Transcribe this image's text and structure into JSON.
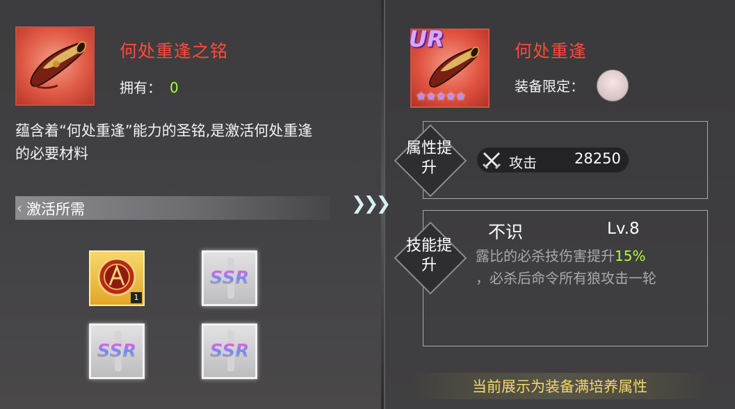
{
  "left": {
    "item_name": "何处重逢之铭",
    "owned_label": "拥有：",
    "owned_value": "0",
    "description": "蕴含着“何处重逢”能力的圣铭,是激活何处重逢的必要材料",
    "section_title": "激活所需",
    "materials": [
      {
        "type": "gold-emblem",
        "count": "1"
      },
      {
        "type": "ssr",
        "label": "SSR"
      },
      {
        "type": "ssr",
        "label": "SSR"
      },
      {
        "type": "ssr",
        "label": "SSR"
      }
    ]
  },
  "right": {
    "rarity_badge": "UR",
    "stars": "★★★★★",
    "equip_name": "何处重逢",
    "limit_label": "装备限定：",
    "attr_title": "属性提升",
    "attr_name": "攻击",
    "attr_value": "28250",
    "skill_title": "技能提升",
    "skill_name": "不识",
    "skill_level": "Lv.8",
    "skill_desc_part1": "露比的必杀技伤害提升",
    "skill_desc_highlight": "15%",
    "skill_desc_part2": "，必杀后命令所有狼攻击一轮",
    "footer_note": "当前展示为装备满培养属性"
  },
  "colors": {
    "title_red": "#ff4a3b",
    "owned_green": "#a6ff3a",
    "highlight_green": "#b4ff3a",
    "footer_yellow": "#f3d86a"
  },
  "icons": {
    "arrow": "triple-chevron-right",
    "attack": "crossed-swords-icon"
  }
}
